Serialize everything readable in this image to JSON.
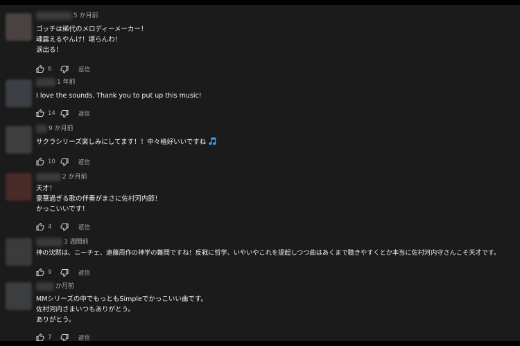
{
  "comments": [
    {
      "time": "5 か月前",
      "lines": [
        "ゴッチは稀代のメロディーメーカー！",
        "魂震えるやんけ！堪らんわ！",
        "涙出る！"
      ],
      "likes": "6",
      "reply_label": "返信"
    },
    {
      "time": "1 年前",
      "lines": [
        "I love the sounds. Thank you to put up this music!"
      ],
      "likes": "14",
      "reply_label": "返信"
    },
    {
      "time": "9 か月前",
      "lines": [
        "サクラシリーズ楽しみにしてます！！中々格好いいですね"
      ],
      "likes": "10",
      "reply_label": "返信"
    },
    {
      "time": "2 か月前",
      "lines": [
        "天才！",
        "豪華過ぎる歌の伴奏がまさに佐村河内節！",
        "かっこいいです！"
      ],
      "likes": "4",
      "reply_label": "返信"
    },
    {
      "time": "3 週間前",
      "lines": [
        "神の沈黙は、ニーチェ、遠藤周作の神学の難問ですね！反戦に哲学、いやいやこれを提起しつつ曲はあくまで聴きやすくとか本当に佐村河内守さんこそ天才です。"
      ],
      "likes": "9",
      "reply_label": "返信"
    },
    {
      "time": "か月前",
      "lines": [
        "MMシリーズの中でもっともSimpleでかっこいい曲です。",
        "佐村河内さまいつもありがとう。",
        "ありがとう。"
      ],
      "likes": "7",
      "reply_label": "返信"
    }
  ],
  "icons": {
    "like": "thumbs-up-icon",
    "dislike": "thumbs-down-icon",
    "emoji": "musical-note-icon"
  },
  "colors": {
    "background": "#1b1b1b",
    "text": "#f1f1f1",
    "meta": "#aaaaaa",
    "emoji_blue": "#3ea6ff"
  }
}
